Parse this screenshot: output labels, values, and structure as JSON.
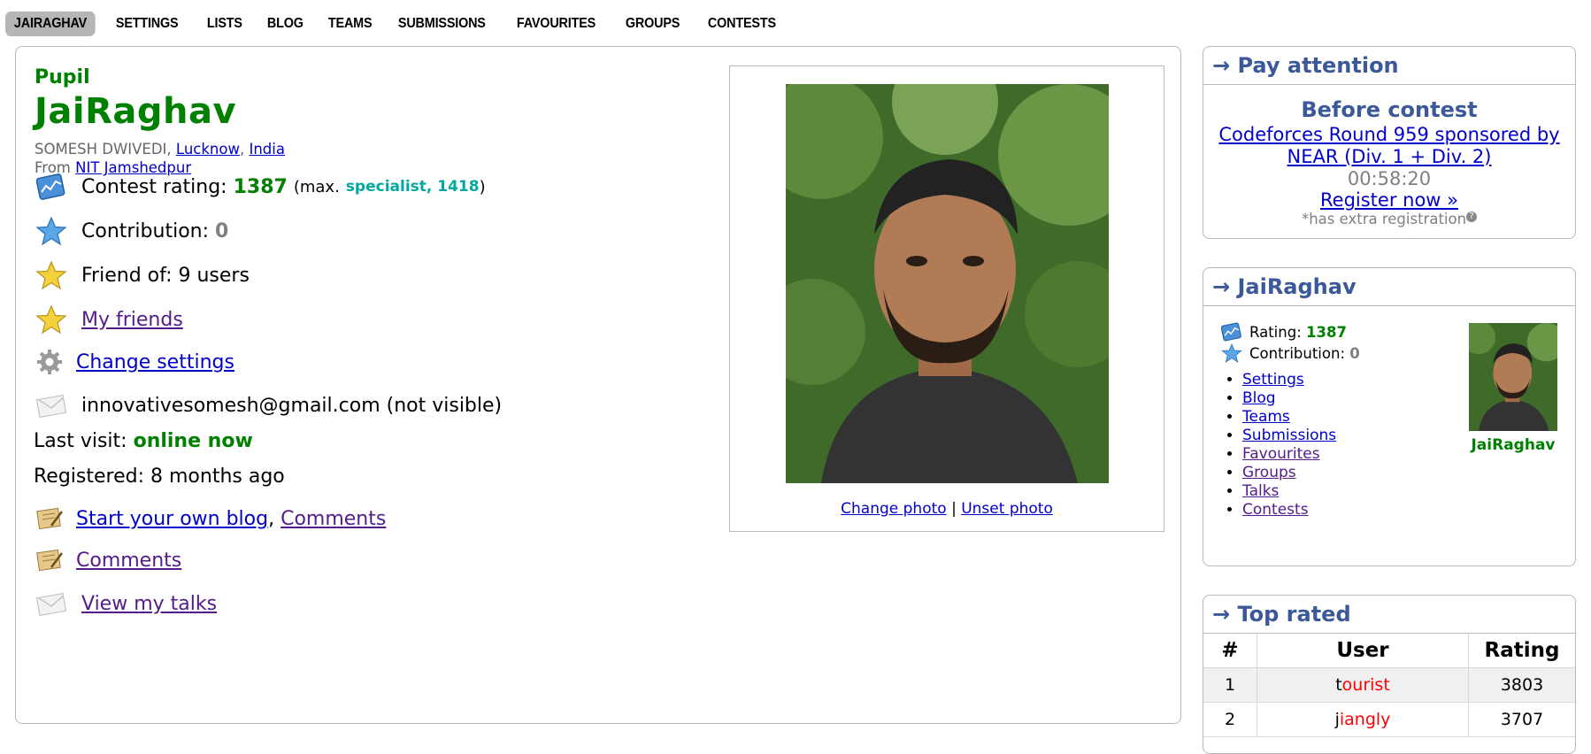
{
  "nav": [
    "JAIRAGHAV",
    "SETTINGS",
    "LISTS",
    "BLOG",
    "TEAMS",
    "SUBMISSIONS",
    "FAVOURITES",
    "GROUPS",
    "CONTESTS"
  ],
  "profile": {
    "rank": "Pupil",
    "handle": "JaiRaghav",
    "name": "SOMESH DWIVEDI",
    "city": "Lucknow",
    "country": "India",
    "from_label": "From",
    "organization": "NIT Jamshedpur",
    "rating_label": "Contest rating:",
    "rating": "1387",
    "max_prefix": "(max.",
    "max_rank_rating": "specialist, 1418",
    "max_suffix": ")",
    "contribution_label": "Contribution:",
    "contribution": "0",
    "friend_of": "Friend of: 9 users",
    "my_friends": "My friends",
    "change_settings": "Change settings",
    "email": "innovativesomesh@gmail.com (not visible)",
    "last_visit_label": "Last visit:",
    "last_visit": "online now",
    "registered": "Registered: 8 months ago",
    "start_blog": "Start your own blog",
    "comments_inline": "Comments",
    "comments": "Comments",
    "view_talks": "View my talks",
    "change_photo": "Change photo",
    "separator": "|",
    "unset_photo": "Unset photo"
  },
  "pay_attention": {
    "caption": "→ Pay attention",
    "title": "Before contest",
    "contest": "Codeforces Round 959 sponsored by NEAR (Div. 1 + Div. 2)",
    "timer": "00:58:20",
    "register": "Register now »",
    "note": "*has extra registration"
  },
  "user_box": {
    "caption": "→ JaiRaghav",
    "rating_label": "Rating:",
    "rating": "1387",
    "contribution_label": "Contribution:",
    "contribution": "0",
    "links": [
      "Settings",
      "Blog",
      "Teams",
      "Submissions",
      "Favourites",
      "Groups",
      "Talks",
      "Contests"
    ],
    "avatar_name": "JaiRaghav"
  },
  "top_rated": {
    "caption": "→ Top rated",
    "headers": [
      "#",
      "User",
      "Rating"
    ],
    "rows": [
      {
        "rank": "1",
        "first": "t",
        "rest": "ourist",
        "rating": "3803"
      },
      {
        "rank": "2",
        "first": "j",
        "rest": "iangly",
        "rating": "3707"
      }
    ]
  },
  "colors": {
    "pupil": "#008000",
    "specialist": "#03a89e",
    "caption": "#3b5998",
    "legendary": "#ff0000"
  }
}
